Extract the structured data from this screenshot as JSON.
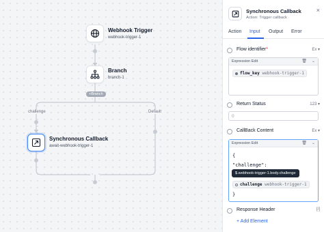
{
  "canvas": {
    "nodes": [
      {
        "title": "Webhook Trigger",
        "sub": "webhook-trigger-1",
        "icon": "globe-icon"
      },
      {
        "title": "Branch",
        "sub": "branch-1",
        "icon": "branch-icon"
      },
      {
        "title": "Synchronous Callback",
        "sub": "await-webhook-trigger-1",
        "icon": "callback-icon"
      }
    ],
    "branch_button": "+Branch",
    "edge_labels": {
      "left": "challenge",
      "right": "Default"
    }
  },
  "panel": {
    "title": "Synchronous Callback",
    "subtitle": "Action: Trigger callback",
    "close": "×",
    "tabs": [
      "Action",
      "Input",
      "Output",
      "Error"
    ],
    "active_tab": "Input",
    "fields": {
      "flow_identifier": {
        "label": "Flow identifier",
        "required": "*",
        "tag": "Ex ▾",
        "editor_label": "Expression Edit",
        "chip_bold": "flow_key",
        "chip_path": "webhook-trigger-1"
      },
      "return_status": {
        "label": "Return Status",
        "tag": "123 ▾",
        "value": "0"
      },
      "callback_content": {
        "label": "CallBack Content",
        "tag": "Ex ▾",
        "editor_label": "Expression Edit",
        "code": [
          "{",
          "\"challenge\":",
          "}"
        ],
        "tooltip": "$.webhook-trigger-1.body.challenge",
        "chip_bold": "challenge",
        "chip_path": "webhook-trigger-1"
      },
      "response_header": {
        "label": "Response Header",
        "tag": "[/]"
      }
    },
    "add_element": "+ Add Element"
  },
  "colors": {
    "accent": "#2563eb",
    "selected_border": "#3b82f6"
  }
}
